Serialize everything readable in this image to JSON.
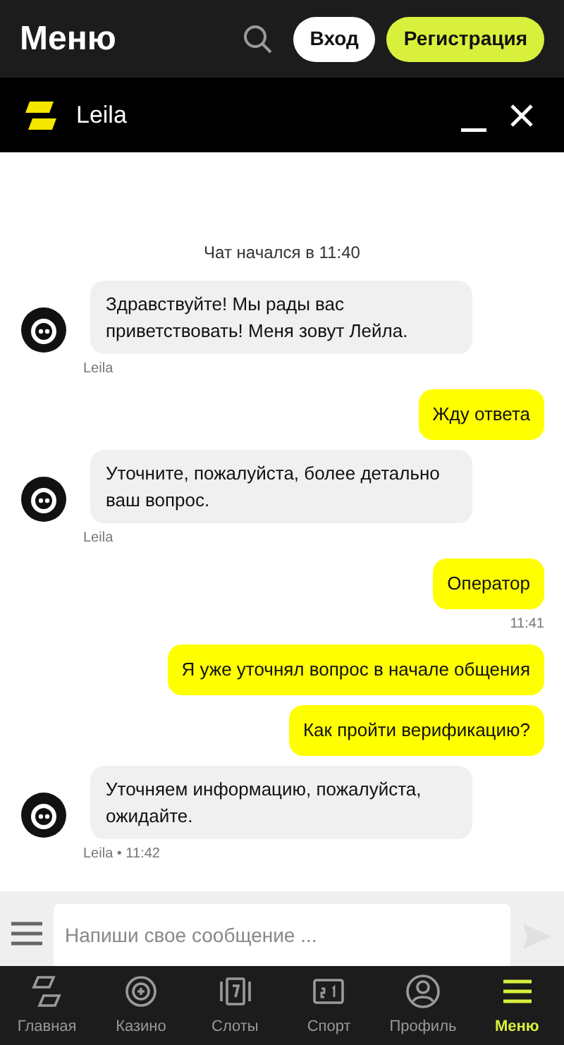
{
  "header": {
    "title": "Меню",
    "login": "Вход",
    "register": "Регистрация"
  },
  "chat_header": {
    "title": "Leila"
  },
  "chat_started": "Чат начался в 11:40",
  "messages": [
    {
      "kind": "agent",
      "text": "Здравствуйте! Мы рады вас приветствовать! Меня зовут Лейла.",
      "meta": "Leila"
    },
    {
      "kind": "user",
      "text": "Жду ответа"
    },
    {
      "kind": "agent",
      "text": "Уточните, пожалуйста, более детально ваш вопрос.",
      "meta": "Leila"
    },
    {
      "kind": "user",
      "text": "Оператор",
      "meta": "11:41"
    },
    {
      "kind": "user",
      "text": "Я уже уточнял вопрос в начале общения"
    },
    {
      "kind": "user",
      "text": "Как пройти верификацию?"
    },
    {
      "kind": "agent",
      "text": "Уточняем информацию, пожалуйста, ожидайте.",
      "meta": "Leila • 11:42"
    }
  ],
  "composer": {
    "placeholder": "Напиши свое сообщение ..."
  },
  "nav": [
    {
      "kind": "home",
      "label": "Главная",
      "selected": false
    },
    {
      "kind": "casino",
      "label": "Казино",
      "selected": false
    },
    {
      "kind": "slots",
      "label": "Слоты",
      "selected": false
    },
    {
      "kind": "sport",
      "label": "Спорт",
      "selected": false
    },
    {
      "kind": "profile",
      "label": "Профиль",
      "selected": false
    },
    {
      "kind": "menu",
      "label": "Меню",
      "selected": true
    }
  ]
}
